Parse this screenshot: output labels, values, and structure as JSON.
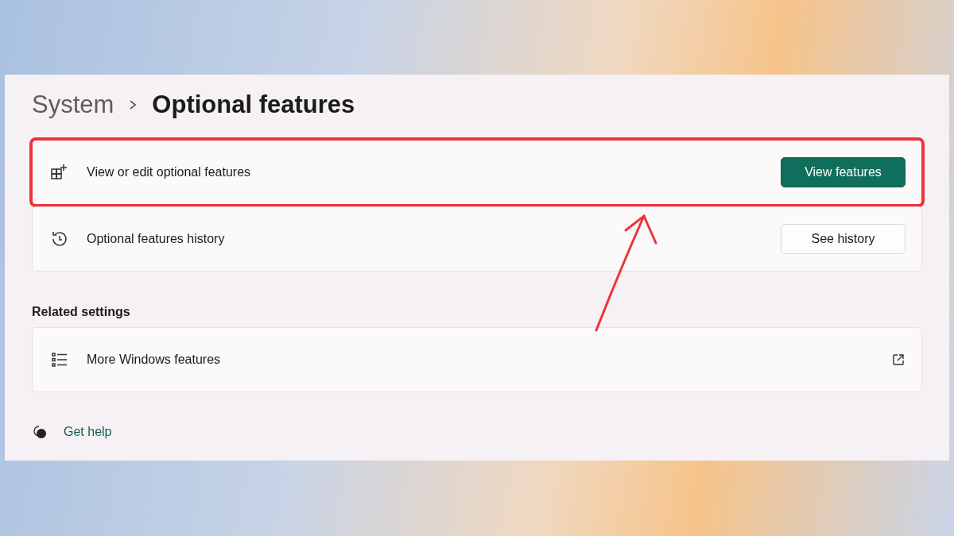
{
  "breadcrumb": [
    {
      "label": "System",
      "current": false
    },
    {
      "label": "Optional features",
      "current": true
    }
  ],
  "feature_rows": [
    {
      "label": "View or edit optional features",
      "highlighted": true,
      "button": {
        "label": "View features",
        "kind": "accent"
      }
    },
    {
      "label": "Optional features history",
      "highlighted": false,
      "button": {
        "label": "See history",
        "kind": "standard"
      }
    }
  ],
  "related_settings": {
    "heading": "Related settings",
    "rows": [
      {
        "label": "More Windows features",
        "kind": "external_link"
      }
    ]
  },
  "help_link": "Get help"
}
